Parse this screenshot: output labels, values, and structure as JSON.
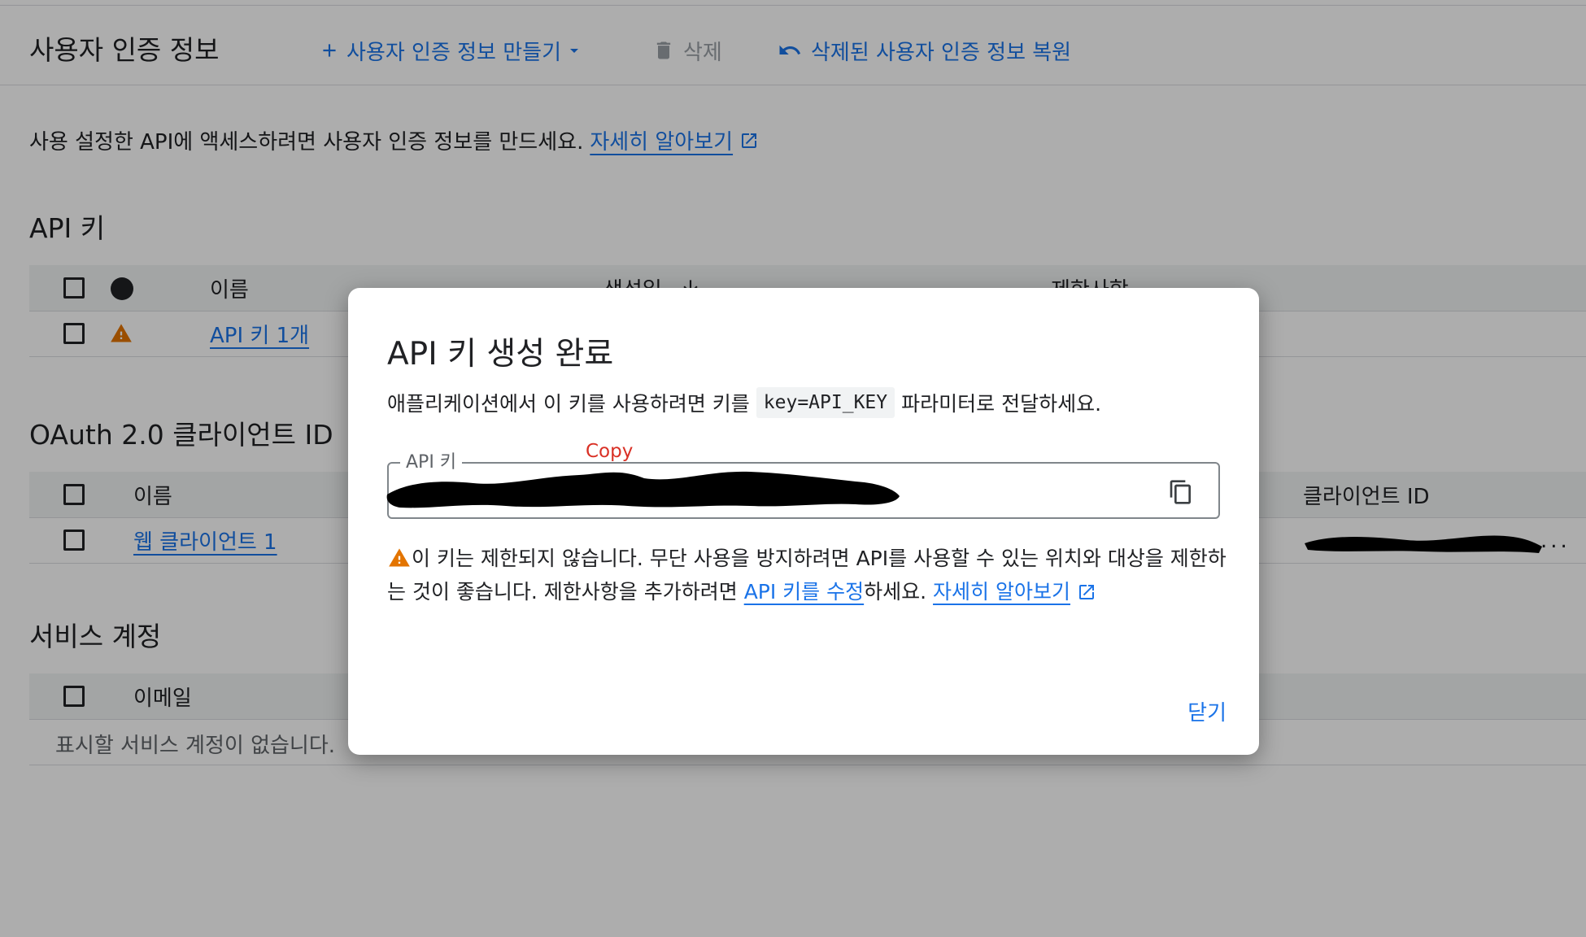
{
  "toolbar": {
    "title": "사용자 인증 정보",
    "create_label": "사용자 인증 정보 만들기",
    "delete_label": "삭제",
    "restore_label": "삭제된 사용자 인증 정보 복원"
  },
  "intro": {
    "text": "사용 설정한 API에 액세스하려면 사용자 인증 정보를 만드세요.",
    "link": "자세히 알아보기"
  },
  "api_keys": {
    "title": "API 키",
    "columns": {
      "name": "이름",
      "created": "생성일",
      "restrictions": "제한사항"
    },
    "rows": [
      {
        "name": "API 키 1개"
      }
    ]
  },
  "oauth": {
    "title": "OAuth 2.0 클라이언트 ID",
    "columns": {
      "name": "이름",
      "client_id": "클라이언트 ID"
    },
    "rows": [
      {
        "name": "웹 클라이언트 1",
        "client_id_suffix": "..."
      }
    ]
  },
  "service_accounts": {
    "title": "서비스 계정",
    "columns": {
      "email": "이메일"
    },
    "empty_text": "표시할 서비스 계정이 없습니다."
  },
  "dialog": {
    "title": "API 키 생성 완료",
    "desc_before": "애플리케이션에서 이 키를 사용하려면 키를",
    "desc_code": "key=API_KEY",
    "desc_after": "파라미터로 전달하세요.",
    "field_label": "API 키",
    "copy_annotation": "Copy",
    "warning_text_1": "이 키는 제한되지 않습니다. 무단 사용을 방지하려면 API를 사용할 수 있는 위치와 대상을 제한하는 것이 좋습니다. 제한사항을 추가하려면 ",
    "warning_link_1": "API 키를 수정",
    "warning_text_2": "하세요. ",
    "warning_link_2": "자세히 알아보기",
    "close_label": "닫기"
  },
  "colors": {
    "accent": "#1a73e8",
    "warning": "#e37400",
    "annotation": "#d93025"
  }
}
